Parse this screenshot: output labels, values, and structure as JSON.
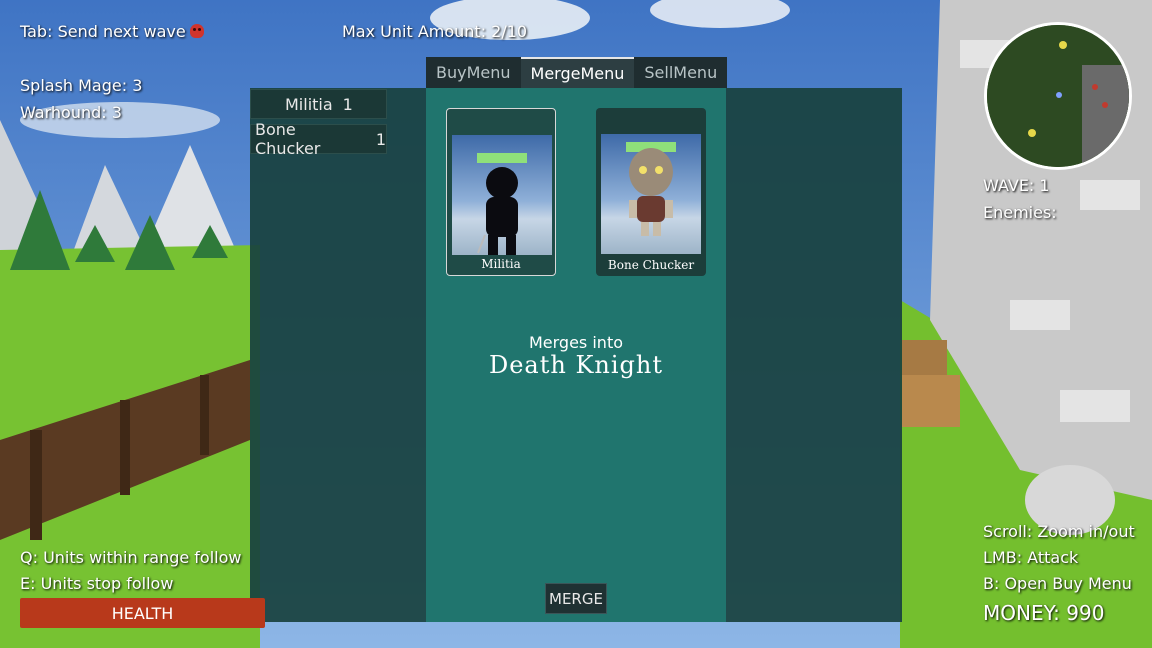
{
  "hud": {
    "send_wave": "Tab: Send next wave",
    "max_units": "Max Unit Amount: 2/10",
    "army": [
      "Splash Mage: 3",
      "Warhound: 3"
    ],
    "wave": "WAVE: 1",
    "enemies": "Enemies:",
    "follow": "Q: Units within range follow",
    "stop_follow": "E: Units stop follow",
    "health": "HEALTH",
    "scroll": "Scroll: Zoom in/out",
    "lmb": "LMB: Attack",
    "buy_hint": "B: Open Buy Menu",
    "money": "MONEY: 990"
  },
  "menu": {
    "tabs": [
      "BuyMenu",
      "MergeMenu",
      "SellMenu"
    ],
    "active_tab": "MergeMenu",
    "owned_units": [
      {
        "name": "Militia",
        "count": "1"
      },
      {
        "name": "Bone Chucker",
        "count": "1"
      }
    ],
    "cards": [
      {
        "name": "Militia",
        "selected": true
      },
      {
        "name": "Bone Chucker",
        "selected": false
      }
    ],
    "merge_caption": "Merges into",
    "merge_result": "Death Knight",
    "merge_button": "MERGE"
  },
  "colors": {
    "panel_dark": "#194240",
    "panel_mid": "#20756e",
    "health_bar": "#b8391b",
    "skull": "#d0342c"
  }
}
